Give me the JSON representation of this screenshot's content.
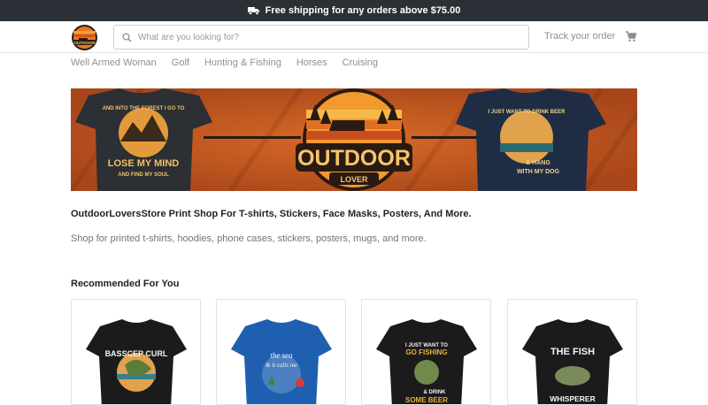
{
  "topbar": {
    "text": "Free shipping for any orders above $75.00",
    "icon": "truck-icon"
  },
  "header": {
    "logo_alt": "OUTDOOR",
    "search_placeholder": "What are you looking for?",
    "track_label": "Track your order",
    "cart_icon": "cart-icon"
  },
  "nav": {
    "items": [
      {
        "label": "Well Armed Woman"
      },
      {
        "label": "Golf"
      },
      {
        "label": "Hunting & Fishing"
      },
      {
        "label": "Horses"
      },
      {
        "label": "Cruising"
      }
    ]
  },
  "banner": {
    "center_title": "OUTDOOR",
    "center_sub": "LOVER",
    "left_shirt_top": "AND INTO THE FOREST I GO TO",
    "left_shirt_main": "LOSE MY MIND",
    "left_shirt_bottom": "AND FIND MY SOUL",
    "right_shirt_top": "I JUST WANT TO DRINK BEER",
    "right_shirt_bottom1": "& HANG",
    "right_shirt_bottom2": "WITH MY DOG"
  },
  "main": {
    "tagline": "OutdoorLoversStore Print Shop For T-shirts, Stickers, Face Masks, Posters, And More.",
    "subtext": "Shop for printed t-shirts, hoodies, phone cases, stickers, posters, mugs, and more.",
    "recommended_title": "Recommended For You"
  },
  "products": [
    {
      "shirt_text": "BASSCEP CURL",
      "shirt_color": "#1b1b1b"
    },
    {
      "shirt_text1": "the sea",
      "shirt_text2": "& it calls me",
      "shirt_color": "#1f5fb0"
    },
    {
      "shirt_text1": "I JUST WANT TO",
      "shirt_text2": "GO FISHING",
      "shirt_text3": "& DRINK",
      "shirt_text4": "SOME BEER",
      "shirt_color": "#1b1b1b"
    },
    {
      "shirt_text1": "THE FISH",
      "shirt_text2": "WHISPERER",
      "shirt_color": "#1b1b1b"
    }
  ],
  "colors": {
    "topbar": "#2a3036",
    "banner_orange": "#c45a1d",
    "accent": "#e87a2c"
  }
}
